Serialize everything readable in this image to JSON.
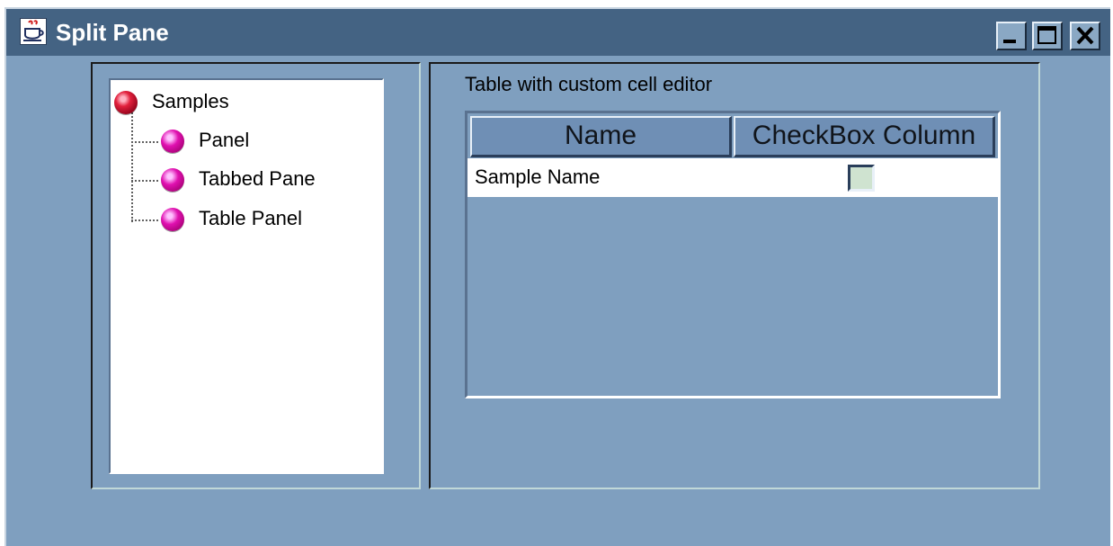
{
  "window": {
    "title": "Split Pane",
    "controls": {
      "minimize": "minimize-icon",
      "maximize": "maximize-icon",
      "close": "close-icon"
    }
  },
  "tree": {
    "root": {
      "label": "Samples",
      "icon": "tree-node-icon"
    },
    "children": [
      {
        "label": "Panel",
        "icon": "tree-node-icon"
      },
      {
        "label": "Tabbed Pane",
        "icon": "tree-node-icon"
      },
      {
        "label": "Table Panel",
        "icon": "tree-node-icon"
      }
    ]
  },
  "right_panel": {
    "label": "Table with custom cell editor",
    "table": {
      "columns": [
        "Name",
        "CheckBox Column"
      ],
      "rows": [
        {
          "name": "Sample Name",
          "checked": false
        }
      ]
    }
  },
  "colors": {
    "window_bg": "#7f9fbf",
    "titlebar": "#446383",
    "header_bg": "#6f8fb5",
    "checkbox_fill": "#cfe3d0"
  }
}
